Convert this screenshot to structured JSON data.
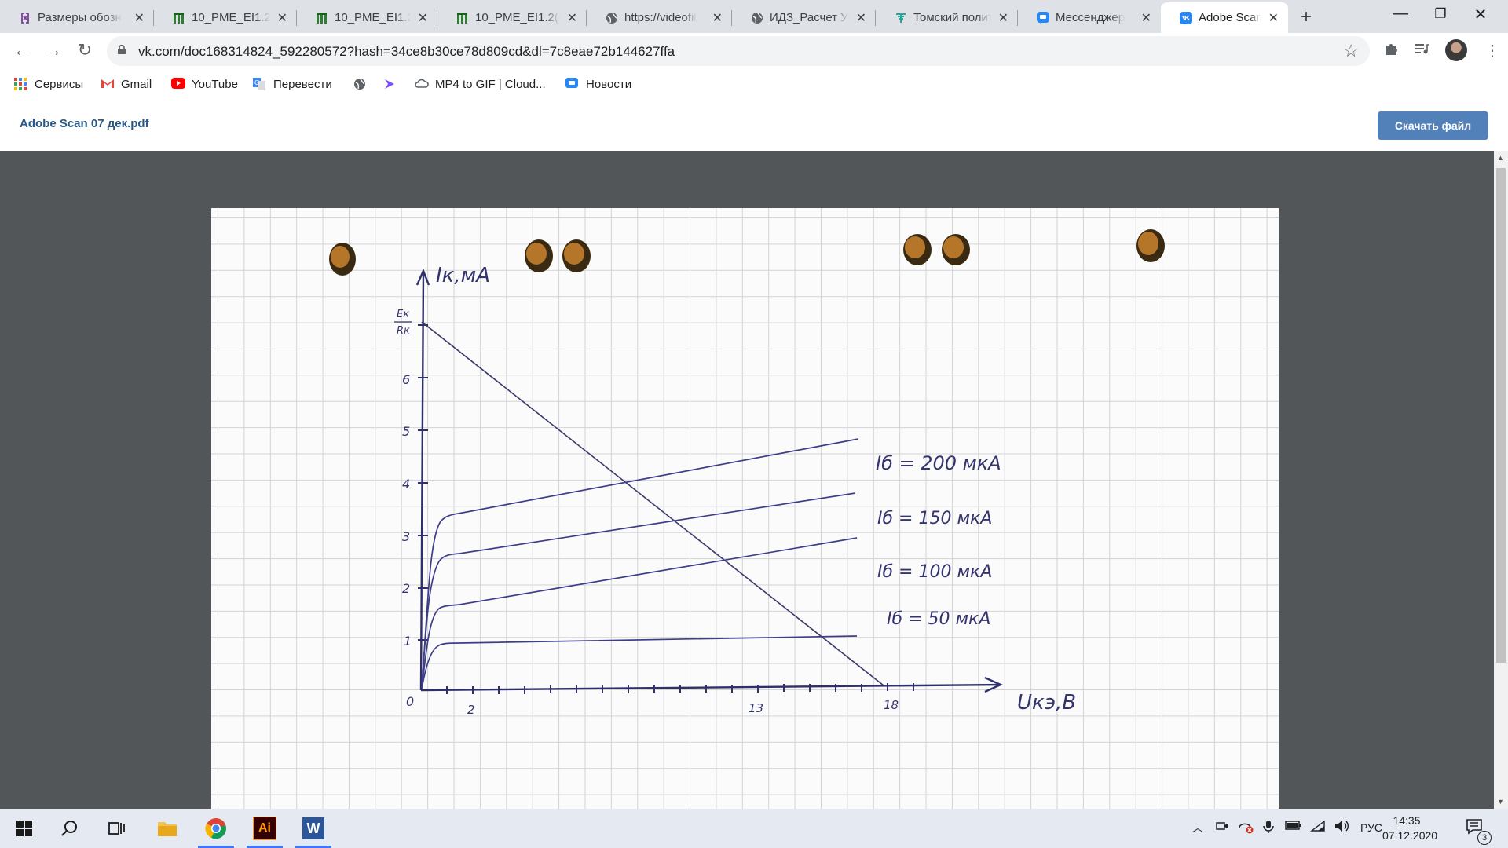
{
  "browser": {
    "tabs": [
      {
        "label": "Размеры обозн",
        "icon": "bracket-logo-icon",
        "color": "#7b3fa0"
      },
      {
        "label": "10_PME_EI1.2(C",
        "icon": "moodle-grid-icon",
        "color": "#2e7d32"
      },
      {
        "label": "10_PME_EI1.2(C",
        "icon": "moodle-grid-icon",
        "color": "#2e7d32"
      },
      {
        "label": "10_PME_EI1.2(C",
        "icon": "moodle-grid-icon",
        "color": "#2e7d32"
      },
      {
        "label": "https://videofil",
        "icon": "globe-icon",
        "color": "#5f6368"
      },
      {
        "label": "ИДЗ_Расчет Ук",
        "icon": "globe-icon",
        "color": "#5f6368"
      },
      {
        "label": "Томский полит",
        "icon": "tpu-logo-icon",
        "color": "#26a69a"
      },
      {
        "label": "Мессенджер",
        "icon": "messenger-icon",
        "color": "#2787f5"
      },
      {
        "label": "Adobe Scan 07",
        "icon": "vk-logo-icon",
        "color": "#2787f5",
        "active": true
      }
    ],
    "url": "vk.com/doc168314824_592280572?hash=34ce8b30ce78d809cd&dl=7c8eae72b144627ffa",
    "bookmarks": [
      {
        "label": "Сервисы",
        "icon": "apps-grid-icon"
      },
      {
        "label": "Gmail",
        "icon": "gmail-icon"
      },
      {
        "label": "YouTube",
        "icon": "youtube-icon"
      },
      {
        "label": "Перевести",
        "icon": "translate-icon"
      },
      {
        "label": "",
        "icon": "globe-icon"
      },
      {
        "label": "",
        "icon": "arrow-logo-icon"
      },
      {
        "label": "MP4 to GIF | Cloud...",
        "icon": "cloud-icon"
      },
      {
        "label": "Новости",
        "icon": "news-chat-icon"
      }
    ]
  },
  "document": {
    "title": "Adobe Scan 07 дек.pdf",
    "download_label": "Скачать файл"
  },
  "scan": {
    "y_axis_label": "Iк,мА",
    "x_axis_label": "Uкэ,В",
    "y_fraction_top": "Ек",
    "y_fraction_bottom": "Rк",
    "y_ticks": [
      "6",
      "5",
      "4",
      "3",
      "2",
      "1"
    ],
    "origin": "0",
    "x_ticks": [
      "2",
      "13",
      "18"
    ],
    "curve_labels": [
      "Iб = 200 мкА",
      "Iб = 150 мкА",
      "Iб = 100 мкА",
      "Iб = 50 мкА"
    ],
    "ink_color": "#3d3d8a"
  },
  "taskbar": {
    "language": "РУС",
    "time": "14:35",
    "date": "07.12.2020",
    "notification_count": "3"
  }
}
